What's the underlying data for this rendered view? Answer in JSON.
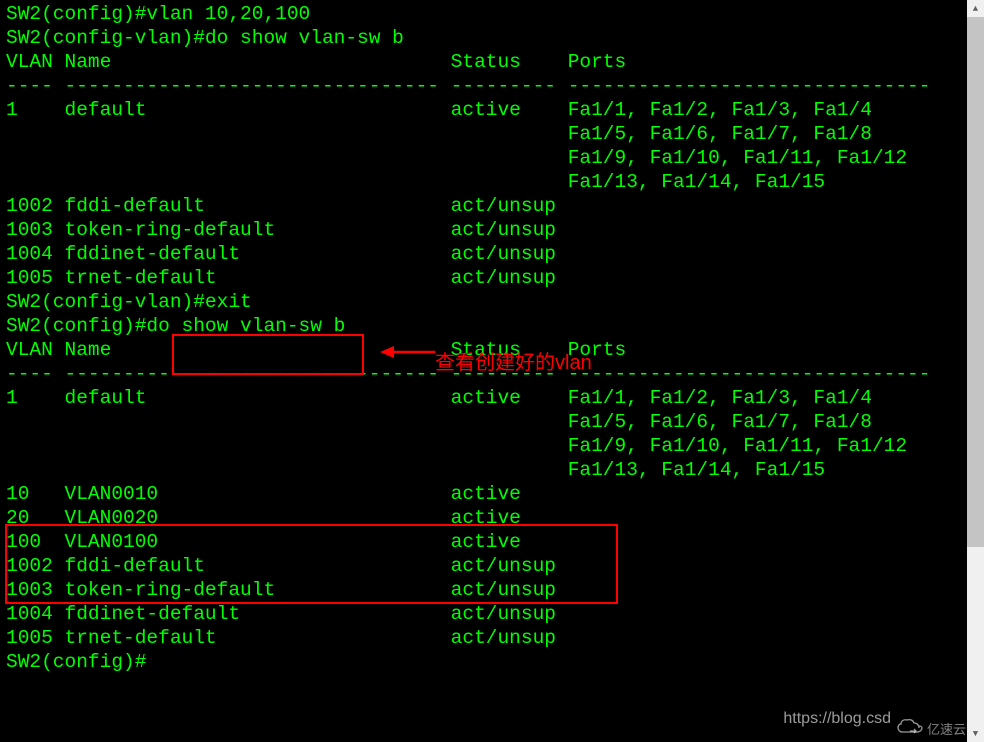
{
  "terminal": {
    "lines": {
      "l0": "SW2(config)#vlan 10,20,100",
      "l1": "SW2(config-vlan)#do show vlan-sw b",
      "l2": "",
      "l3": "VLAN Name                             Status    Ports",
      "l4": "---- -------------------------------- --------- -------------------------------",
      "l5": "1    default                          active    Fa1/1, Fa1/2, Fa1/3, Fa1/4",
      "l6": "                                                Fa1/5, Fa1/6, Fa1/7, Fa1/8",
      "l7": "                                                Fa1/9, Fa1/10, Fa1/11, Fa1/12",
      "l8": "                                                Fa1/13, Fa1/14, Fa1/15",
      "l9": "1002 fddi-default                     act/unsup",
      "l10": "1003 token-ring-default               act/unsup",
      "l11": "1004 fddinet-default                  act/unsup",
      "l12": "1005 trnet-default                    act/unsup",
      "l13": "SW2(config-vlan)#exit",
      "l14": "SW2(config)#do show vlan-sw b",
      "l15": "",
      "l16": "VLAN Name                             Status    Ports",
      "l17": "---- -------------------------------- --------- -------------------------------",
      "l18": "1    default                          active    Fa1/1, Fa1/2, Fa1/3, Fa1/4",
      "l19": "                                                Fa1/5, Fa1/6, Fa1/7, Fa1/8",
      "l20": "                                                Fa1/9, Fa1/10, Fa1/11, Fa1/12",
      "l21": "                                                Fa1/13, Fa1/14, Fa1/15",
      "l22": "10   VLAN0010                         active",
      "l23": "20   VLAN0020                         active",
      "l24": "100  VLAN0100                         active",
      "l25": "1002 fddi-default                     act/unsup",
      "l26": "1003 token-ring-default               act/unsup",
      "l27": "1004 fddinet-default                  act/unsup",
      "l28": "1005 trnet-default                    act/unsup",
      "l29": "SW2(config)#"
    }
  },
  "annotation": {
    "text": "查看创建好的vlan"
  },
  "watermark": {
    "url_text": "https://blog.csd",
    "logo_text": "亿速云"
  }
}
